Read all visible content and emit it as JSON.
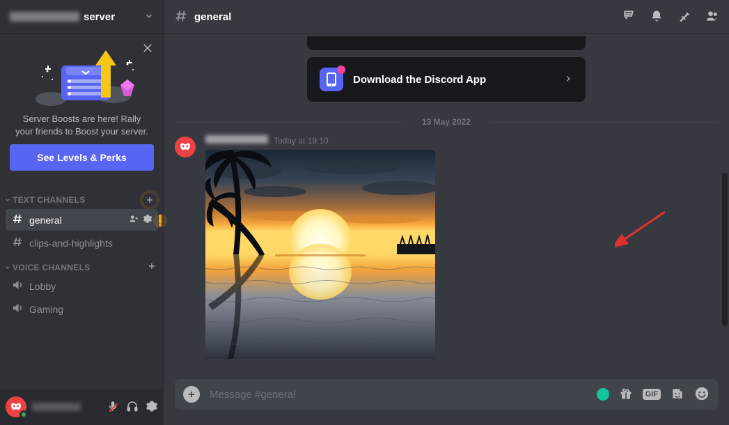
{
  "server": {
    "name_suffix": "server"
  },
  "sidebar": {
    "boost": {
      "text": "Server Boosts are here! Rally your friends to Boost your server.",
      "button": "See Levels & Perks"
    },
    "text_channels": {
      "header": "TEXT CHANNELS",
      "items": [
        "general",
        "clips-and-highlights"
      ]
    },
    "voice_channels": {
      "header": "VOICE CHANNELS",
      "items": [
        "Lobby",
        "Gaming"
      ]
    }
  },
  "header": {
    "channel": "general"
  },
  "content": {
    "download_card": "Download the Discord App",
    "date_divider": "13 May 2022",
    "message": {
      "timestamp": "Today at 19:10"
    }
  },
  "composer": {
    "placeholder": "Message #general"
  }
}
